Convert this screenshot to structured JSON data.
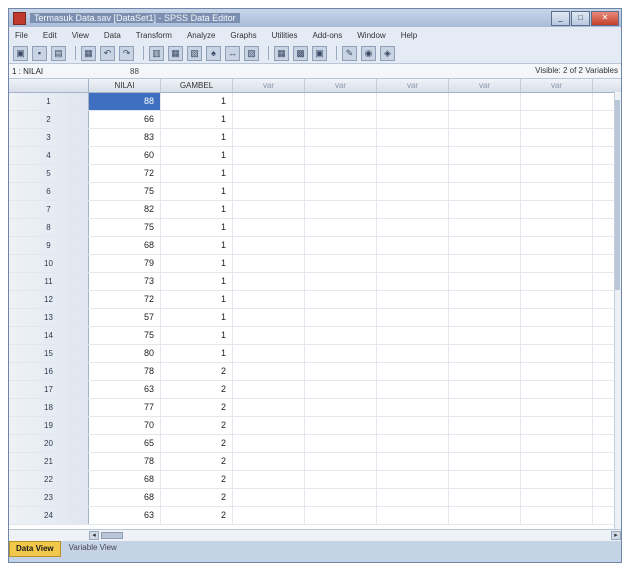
{
  "window": {
    "title": "Termasuk Data.sav [DataSet1] - SPSS Data Editor"
  },
  "menu": [
    "File",
    "Edit",
    "View",
    "Data",
    "Transform",
    "Analyze",
    "Graphs",
    "Utilities",
    "Add-ons",
    "Window",
    "Help"
  ],
  "cellbar": {
    "ref": "1 : NILAI",
    "value": "88",
    "visible_info": "Visible: 2 of 2 Variables"
  },
  "columns": [
    "NILAI",
    "GAMBEL",
    "var",
    "var",
    "var",
    "var",
    "var"
  ],
  "rows": [
    {
      "n": "1",
      "nilai": "88",
      "gambel": "1"
    },
    {
      "n": "2",
      "nilai": "66",
      "gambel": "1"
    },
    {
      "n": "3",
      "nilai": "83",
      "gambel": "1"
    },
    {
      "n": "4",
      "nilai": "60",
      "gambel": "1"
    },
    {
      "n": "5",
      "nilai": "72",
      "gambel": "1"
    },
    {
      "n": "6",
      "nilai": "75",
      "gambel": "1"
    },
    {
      "n": "7",
      "nilai": "82",
      "gambel": "1"
    },
    {
      "n": "8",
      "nilai": "75",
      "gambel": "1"
    },
    {
      "n": "9",
      "nilai": "68",
      "gambel": "1"
    },
    {
      "n": "10",
      "nilai": "79",
      "gambel": "1"
    },
    {
      "n": "11",
      "nilai": "73",
      "gambel": "1"
    },
    {
      "n": "12",
      "nilai": "72",
      "gambel": "1"
    },
    {
      "n": "13",
      "nilai": "57",
      "gambel": "1"
    },
    {
      "n": "14",
      "nilai": "75",
      "gambel": "1"
    },
    {
      "n": "15",
      "nilai": "80",
      "gambel": "1"
    },
    {
      "n": "16",
      "nilai": "78",
      "gambel": "2"
    },
    {
      "n": "17",
      "nilai": "63",
      "gambel": "2"
    },
    {
      "n": "18",
      "nilai": "77",
      "gambel": "2"
    },
    {
      "n": "19",
      "nilai": "70",
      "gambel": "2"
    },
    {
      "n": "20",
      "nilai": "65",
      "gambel": "2"
    },
    {
      "n": "21",
      "nilai": "78",
      "gambel": "2"
    },
    {
      "n": "22",
      "nilai": "68",
      "gambel": "2"
    },
    {
      "n": "23",
      "nilai": "68",
      "gambel": "2"
    },
    {
      "n": "24",
      "nilai": "63",
      "gambel": "2"
    }
  ],
  "tabs": [
    "Data View",
    "Variable View"
  ]
}
